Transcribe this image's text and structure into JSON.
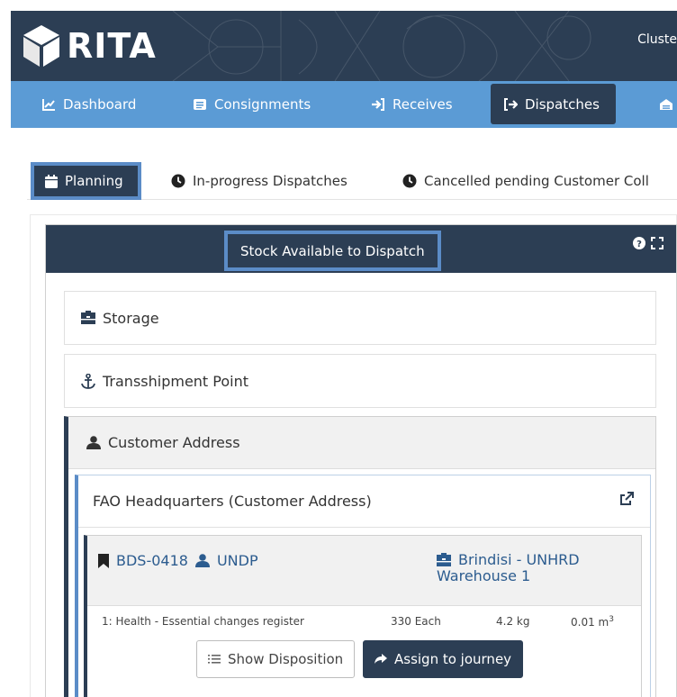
{
  "brand": {
    "logo_text": "RITA"
  },
  "header": {
    "cluster_text": "Cluste"
  },
  "nav": [
    {
      "label": "Dashboard",
      "icon": "line-chart-icon"
    },
    {
      "label": "Consignments",
      "icon": "list-icon"
    },
    {
      "label": "Receives",
      "icon": "sign-in-icon"
    },
    {
      "label": "Dispatches",
      "icon": "sign-out-icon",
      "active": true
    },
    {
      "label": "",
      "icon": "warehouse-icon"
    }
  ],
  "subtabs": [
    {
      "label": "Planning",
      "icon": "calendar-icon",
      "active": true
    },
    {
      "label": "In-progress Dispatches",
      "icon": "clock-icon"
    },
    {
      "label": "Cancelled pending Customer Coll",
      "icon": "clock-icon"
    }
  ],
  "panel": {
    "title": "Stock Available to Dispatch",
    "tools": [
      "question-circle-icon",
      "expand-icon"
    ]
  },
  "locations": {
    "storage": "Storage",
    "transshipment": "Transshipment Point",
    "customer": "Customer Address"
  },
  "fao": {
    "title": "FAO Headquarters (Customer Address)"
  },
  "bds": {
    "ref": "BDS-0418",
    "org": "UNDP",
    "warehouse_line1": "Brindisi - UNHRD",
    "warehouse_line2": "Warehouse 1",
    "item": {
      "description": "1: Health - Essential changes register",
      "quantity": "330 Each",
      "weight": "4.2 kg",
      "volume": "0.01 m",
      "volume_exp": "3"
    },
    "show_disposition": "Show Disposition",
    "assign": "Assign to journey"
  },
  "colors": {
    "navy": "#2c3e54",
    "nav_blue": "#5b9bd5",
    "link_blue": "#2c5c8f",
    "highlight_border": "#5b8cc7"
  }
}
